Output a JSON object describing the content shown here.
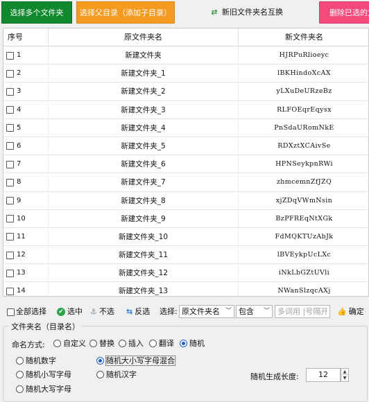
{
  "toolbar": {
    "select_multiple": "选择多个文件夹",
    "select_parent": "选择父目录（添加子目录）",
    "swap_names": "新旧文件夹名互换",
    "delete_selected": "删除已选的文"
  },
  "table": {
    "headers": {
      "index": "序号",
      "old_name": "原文件夹名",
      "new_name": "新文件夹名"
    },
    "rows": [
      {
        "index": "1",
        "old_name": "新建文件夹",
        "new_name": "HJRPuRlioeyc"
      },
      {
        "index": "2",
        "old_name": "新建文件夹_1",
        "new_name": "lBKHindoXcAX"
      },
      {
        "index": "3",
        "old_name": "新建文件夹_2",
        "new_name": "yLXuDeURzeBz"
      },
      {
        "index": "4",
        "old_name": "新建文件夹_3",
        "new_name": "RLFOEqrEqysx"
      },
      {
        "index": "5",
        "old_name": "新建文件夹_4",
        "new_name": "PnSdaURomNkE"
      },
      {
        "index": "6",
        "old_name": "新建文件夹_5",
        "new_name": "RDXztXCAivSe"
      },
      {
        "index": "7",
        "old_name": "新建文件夹_6",
        "new_name": "HPNSeykpnRWi"
      },
      {
        "index": "8",
        "old_name": "新建文件夹_7",
        "new_name": "zhmcemnZfJZQ"
      },
      {
        "index": "9",
        "old_name": "新建文件夹_8",
        "new_name": "xjZDqVWmNsin"
      },
      {
        "index": "10",
        "old_name": "新建文件夹_9",
        "new_name": "BzPFREqNtXGk"
      },
      {
        "index": "11",
        "old_name": "新建文件夹_10",
        "new_name": "FdMQKTUzAbJk"
      },
      {
        "index": "12",
        "old_name": "新建文件夹_11",
        "new_name": "lBVEykpUcLXc"
      },
      {
        "index": "13",
        "old_name": "新建文件夹_12",
        "new_name": "iNkLbGZtUVli"
      },
      {
        "index": "14",
        "old_name": "新建文件夹_13",
        "new_name": "NWanSlzqcAXj"
      }
    ]
  },
  "selection_bar": {
    "select_all": "全部选择",
    "select": "选中",
    "unselect": "不选",
    "invert": "反选",
    "filter_label": "选择:",
    "field_value": "原文件夹名",
    "operator_value": "包含",
    "keyword_placeholder": "多词用 |号隔开",
    "confirm": "确定"
  },
  "naming": {
    "group_title": "文件夹名（目录名）",
    "method_label": "命名方式:",
    "methods": [
      "自定义",
      "替换",
      "插入",
      "翻译",
      "随机"
    ],
    "selected_method": "随机",
    "random_types": [
      "随机数字",
      "随机大小写字母混合",
      "随机小写字母",
      "随机汉字",
      "随机大写字母"
    ],
    "selected_random_type": "随机大小写字母混合",
    "length_label": "随机生成长度:",
    "length_value": "12"
  },
  "colors": {
    "green_button": "#10892e",
    "orange_button": "#f39a1f",
    "pink_button": "#f5497c",
    "radio_selected": "#1a5fd0"
  }
}
